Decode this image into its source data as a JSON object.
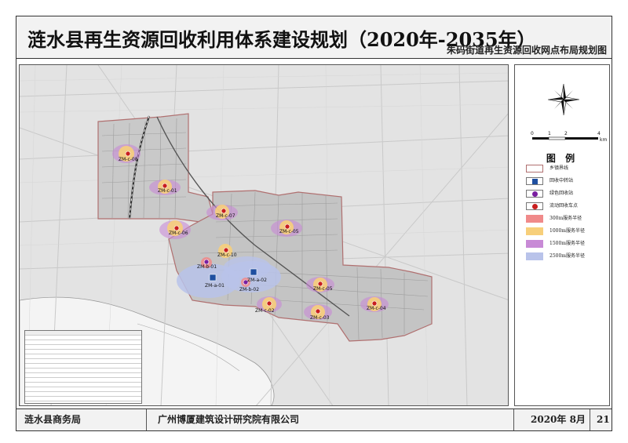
{
  "header": {
    "title": "涟水县再生资源回收利用体系建设规划（2020年-2035年）",
    "subtitle": "朱码街道再生资源回收网点布局规划图"
  },
  "footer": {
    "agency": "涟水县商务局",
    "designer": "广州博厦建筑设计研究院有限公司",
    "date": "2020年 8月",
    "page": "21"
  },
  "scale_bar": {
    "ticks": [
      "0",
      "1",
      "2",
      "4"
    ],
    "unit": "km"
  },
  "legend": {
    "title": "图 例",
    "items": [
      {
        "label": "乡镇界线",
        "symbol": "boundary",
        "color": "#b07070"
      },
      {
        "label": "回收中转站",
        "symbol": "blue-square",
        "color": "#1f4fa0"
      },
      {
        "label": "绿色回收站",
        "symbol": "purple-dot",
        "color": "#7a1fa0"
      },
      {
        "label": "流动回收车点",
        "symbol": "red-dot",
        "color": "#c81e1e"
      },
      {
        "label": "300m服务半径",
        "symbol": "fill",
        "color": "#f08a8a"
      },
      {
        "label": "1000m服务半径",
        "symbol": "fill",
        "color": "#f7cf7a"
      },
      {
        "label": "1500m服务半径",
        "symbol": "fill",
        "color": "#c88ad6"
      },
      {
        "label": "2500m服务半径",
        "symbol": "fill",
        "color": "#b9c3ea"
      }
    ]
  },
  "map_points": [
    {
      "label": "ZM-c-08",
      "type": "mobile"
    },
    {
      "label": "ZM-c-01",
      "type": "mobile"
    },
    {
      "label": "ZM-c-07",
      "type": "mobile"
    },
    {
      "label": "ZM-c-06",
      "type": "mobile"
    },
    {
      "label": "ZM-c-05",
      "type": "mobile"
    },
    {
      "label": "ZM-c-10",
      "type": "mobile"
    },
    {
      "label": "ZM-b-01",
      "type": "green"
    },
    {
      "label": "ZM-a-01",
      "type": "transfer"
    },
    {
      "label": "ZM-a-02",
      "type": "transfer"
    },
    {
      "label": "ZM-b-02",
      "type": "green"
    },
    {
      "label": "ZM-c-05",
      "type": "mobile"
    },
    {
      "label": "ZM-c-02",
      "type": "mobile"
    },
    {
      "label": "ZM-c-03",
      "type": "mobile"
    },
    {
      "label": "ZM-c-04",
      "type": "mobile"
    }
  ],
  "colors": {
    "transfer": "#1f4fa0",
    "green": "#7a1fa0",
    "mobile": "#c81e1e",
    "boundary": "#b07070"
  }
}
